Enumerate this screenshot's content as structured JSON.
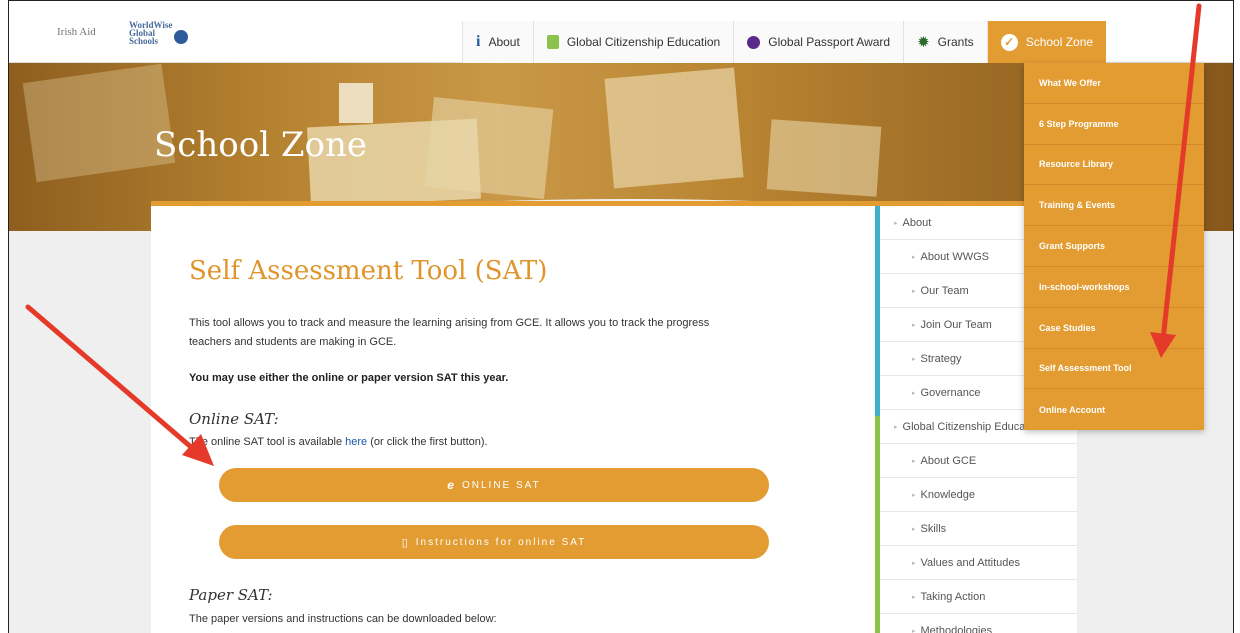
{
  "logos": {
    "irish_aid": "Irish Aid",
    "worldwise": [
      "WorldWise",
      "Global",
      "Schools"
    ]
  },
  "nav": {
    "items": [
      {
        "label": "About",
        "icon": "info-icon"
      },
      {
        "label": "Global Citizenship Education",
        "icon": "book-icon"
      },
      {
        "label": "Global Passport Award",
        "icon": "globe-icon"
      },
      {
        "label": "Grants",
        "icon": "gear-icon"
      },
      {
        "label": "School Zone",
        "icon": "check-circle-icon"
      }
    ]
  },
  "hero": {
    "title": "School Zone"
  },
  "dropdown": {
    "items": [
      "What We Offer",
      "6 Step Programme",
      "Resource Library",
      "Training & Events",
      "Grant Supports",
      "In-school-workshops",
      "Case Studies",
      "Self Assessment Tool",
      "Online Account"
    ]
  },
  "main": {
    "title": "Self Assessment Tool (SAT)",
    "intro_line1": "This tool allows you to track and measure the learning arising from GCE. It allows you to track the progress",
    "intro_line2": "teachers and students are making in GCE.",
    "notice": "You may use either the online or paper version SAT this year.",
    "online_heading": "Online SAT:",
    "online_text_prefix": "The online SAT tool is available ",
    "online_link": "here",
    "online_text_suffix": " (or click the first button).",
    "btn_online": "ONLINE SAT",
    "btn_instructions": "Instructions for online SAT",
    "paper_heading": "Paper SAT:",
    "paper_text": "The paper versions and instructions can be downloaded below:"
  },
  "side": {
    "items": [
      {
        "label": "About",
        "level": 0
      },
      {
        "label": "About WWGS",
        "level": 1
      },
      {
        "label": "Our Team",
        "level": 1
      },
      {
        "label": "Join Our Team",
        "level": 1
      },
      {
        "label": "Strategy",
        "level": 1
      },
      {
        "label": "Governance",
        "level": 1
      },
      {
        "label": "Global Citizenship Education",
        "level": 0
      },
      {
        "label": "About GCE",
        "level": 1
      },
      {
        "label": "Knowledge",
        "level": 1
      },
      {
        "label": "Skills",
        "level": 1
      },
      {
        "label": "Values and Attitudes",
        "level": 1
      },
      {
        "label": "Taking Action",
        "level": 1
      },
      {
        "label": "Methodologies",
        "level": 1
      }
    ]
  },
  "colors": {
    "accent": "#e29c32",
    "link": "#1a57a5",
    "arrow": "#e53a2a"
  }
}
